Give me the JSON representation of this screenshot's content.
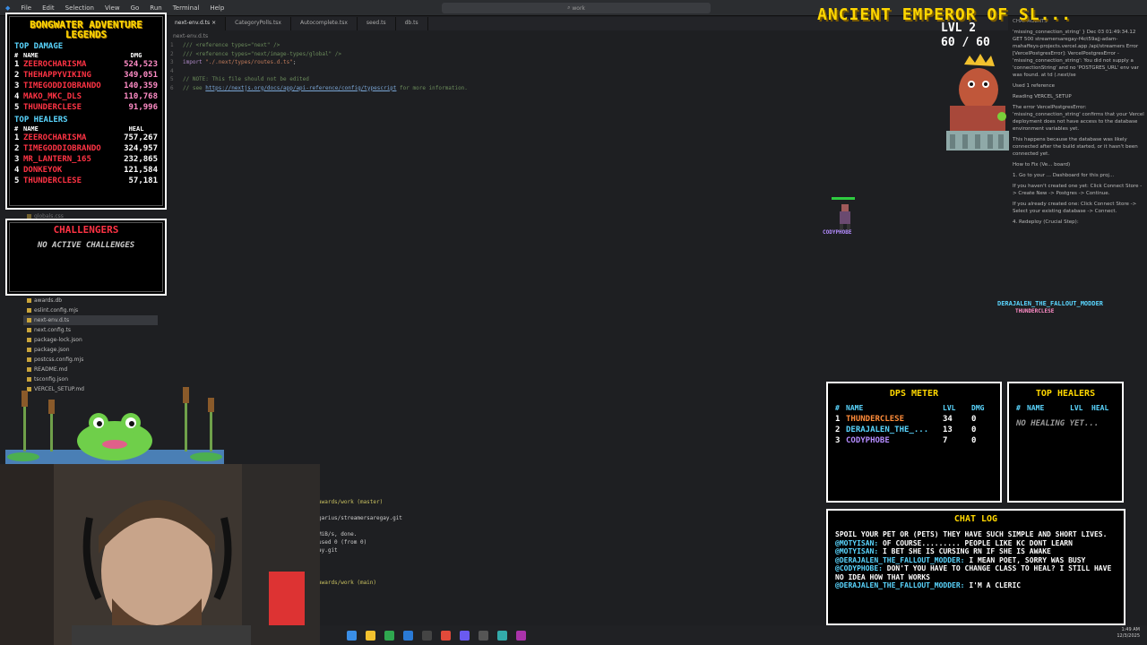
{
  "ide": {
    "menu": [
      "File",
      "Edit",
      "Selection",
      "View",
      "Go",
      "Run",
      "Terminal",
      "Help"
    ],
    "search_label": "work",
    "tabs": [
      "next-env.d.ts",
      "CategoryPolls.tsx",
      "Autocomplete.tsx",
      "seed.ts",
      "db.ts"
    ],
    "breadcrumb": "next-env.d.ts",
    "code_lines": [
      {
        "n": "1",
        "segments": [
          [
            "c-com",
            "/// <reference types=\"next\" />"
          ]
        ]
      },
      {
        "n": "2",
        "segments": [
          [
            "c-com",
            "/// <reference types=\"next/image-types/global\" />"
          ]
        ]
      },
      {
        "n": "3",
        "segments": [
          [
            "c-kw",
            "import "
          ],
          [
            "c-str",
            "\"./.next/types/routes.d.ts\""
          ],
          [
            "",
            "; "
          ]
        ]
      },
      {
        "n": "4",
        "segments": [
          [
            "",
            ""
          ]
        ]
      },
      {
        "n": "5",
        "segments": [
          [
            "c-com",
            "// NOTE: This file should not be edited"
          ]
        ]
      },
      {
        "n": "6",
        "segments": [
          [
            "c-com",
            "// see "
          ],
          [
            "c-link",
            "https://nextjs.org/docs/app/api-reference/config/typescript"
          ],
          [
            "c-com",
            " for more information."
          ]
        ]
      }
    ],
    "explorer": [
      "globals.css",
      "awards.db",
      "eslint.config.mjs",
      "next-env.d.ts",
      "next.config.ts",
      "package-lock.json",
      "package.json",
      "postcss.config.mjs",
      "README.md",
      "tsconfig.json",
      "VERCEL_SETUP.md"
    ],
    "terminal_lines": [
      "awards/work (master)",
      "",
      "garius/streamersaregay.git",
      "",
      "MiB/s, done.",
      "used 0 (from 0)",
      "ay.git",
      "",
      "",
      "",
      "awards/work (main)"
    ],
    "copilot": {
      "header": "CHAT   AGENTS",
      "paragraphs": [
        "'missing_connection_string' } Dec 03 01:49:34.12 GET 500 streamersaregay-f4ct59ajj-adam-mahaffeys-projects.vercel.app /api/streamers Error [VercelPostgresError]: VercelPostgresError - 'missing_connection_string': You did not supply a 'connectionString' and no 'POSTGRES_URL' env var was found. at td (.next/se",
        "Used 1 reference",
        "Reading VERCEL_SETUP",
        "The error VercelPostgresError: 'missing_connection_string' confirms that your Vercel deployment does not have access to the database environment variables yet.",
        "This happens because the database was likely connected after the build started, or it hasn't been connected yet.",
        "How to Fix (Ve... board)",
        "1. Go to your ... Dashboard for this proj...",
        "If you haven't created one yet: Click Connect Store -> Create New -> Postgres -> Continue.",
        "If you already created one: Click Connect Store -> Select your existing database -> Connect.",
        "4. Redeploy (Crucial Step):"
      ]
    }
  },
  "game": {
    "title": "ANCIENT EMPEROR OF SL...",
    "level": "LVL 2",
    "hp": "60 / 60",
    "player_name": "CODYPHOBE",
    "player2_name": "DERAJALEN_THE_FALLOUT_MODDER",
    "player3_name": "THUNDERCLESE"
  },
  "leaderboard": {
    "title_line1": "BONGWATER ADVENTURE",
    "title_line2": "LEGENDS",
    "damage_title": "TOP DAMAGE",
    "damage_cols": [
      "#",
      "NAME",
      "DMG"
    ],
    "damage_rows": [
      {
        "n": "1",
        "name": "ZEEROCHARISMA",
        "v": "524,523"
      },
      {
        "n": "2",
        "name": "THEHAPPYVIKING",
        "v": "349,051"
      },
      {
        "n": "3",
        "name": "TIMEGODDIOBRANDO",
        "v": "140,359"
      },
      {
        "n": "4",
        "name": "MAKO_MKC_DLS",
        "v": "110,768"
      },
      {
        "n": "5",
        "name": "THUNDERCLESE",
        "v": "91,996"
      }
    ],
    "heal_title": "TOP HEALERS",
    "heal_cols": [
      "#",
      "NAME",
      "HEAL"
    ],
    "heal_rows": [
      {
        "n": "1",
        "name": "ZEEROCHARISMA",
        "v": "757,267"
      },
      {
        "n": "2",
        "name": "TIMEGODDIOBRANDO",
        "v": "324,957"
      },
      {
        "n": "3",
        "name": "MR_LANTERN_165",
        "v": "232,865"
      },
      {
        "n": "4",
        "name": "DONKEYOK",
        "v": "121,584"
      },
      {
        "n": "5",
        "name": "THUNDERCLESE",
        "v": "57,181"
      }
    ]
  },
  "challengers": {
    "title": "CHALLENGERS",
    "status": "NO ACTIVE CHALLENGES"
  },
  "dps": {
    "title": "DPS METER",
    "cols": [
      "#",
      "NAME",
      "LVL",
      "DMG"
    ],
    "rows": [
      {
        "n": "1",
        "name": "THUNDERCLESE",
        "lvl": "34",
        "dmg": "0",
        "color": "#ff8c3a"
      },
      {
        "n": "2",
        "name": "DERAJALEN_THE_...",
        "lvl": "13",
        "dmg": "0",
        "color": "#5ad6ff"
      },
      {
        "n": "3",
        "name": "CODYPHOBE",
        "lvl": "7",
        "dmg": "0",
        "color": "#b48cff"
      }
    ]
  },
  "healers": {
    "title": "TOP HEALERS",
    "cols": [
      "#",
      "NAME",
      "LVL",
      "HEAL"
    ],
    "empty": "NO HEALING YET..."
  },
  "chat": {
    "title": "CHAT LOG",
    "messages": [
      {
        "user": "",
        "text": "SPOIL YOUR PET OR (PETS) THEY HAVE SUCH SIMPLE AND SHORT LIVES."
      },
      {
        "user": "@MOTYISAN:",
        "text": " OF COURSE......... PEOPLE LIKE KC DONT LEARN"
      },
      {
        "user": "@MOTYISAN:",
        "text": " I BET SHE IS CURSING RN IF SHE IS AWAKE"
      },
      {
        "user": "@DERAJALEN_THE_FALLOUT_MODDER:",
        "text": " I MEAN POET, SORRY WAS BUSY"
      },
      {
        "user": "@CODYPHOBE:",
        "text": " DON'T YOU HAVE TO CHANGE CLASS TO HEAL? I STILL HAVE NO IDEA HOW THAT WORKS"
      },
      {
        "user": "@DERAJALEN_THE_FALLOUT_MODDER:",
        "text": " I'M A CLERIC"
      }
    ]
  },
  "clock": {
    "time": "1:49 AM",
    "date": "12/3/2025"
  }
}
